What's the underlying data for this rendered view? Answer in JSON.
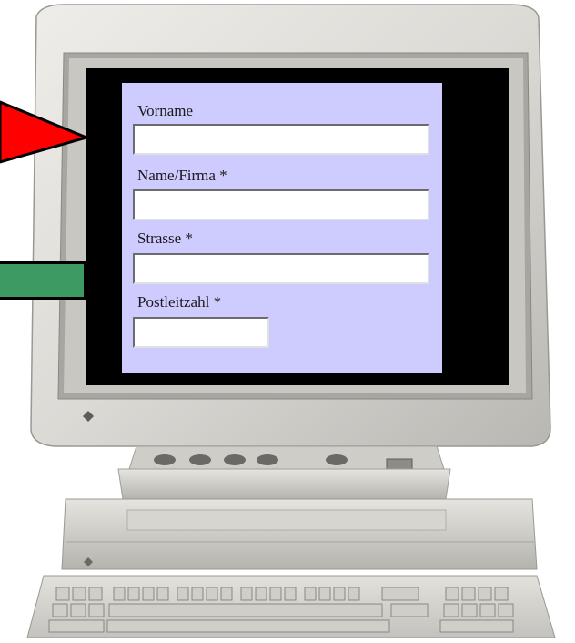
{
  "form": {
    "fields": [
      {
        "label": "Vorname",
        "value": ""
      },
      {
        "label": "Name/Firma *",
        "value": ""
      },
      {
        "label": "Strasse *",
        "value": ""
      },
      {
        "label": "Postleitzahl *",
        "value": ""
      }
    ]
  },
  "colors": {
    "form_background": "#cecbff",
    "arrow": "#ff0000",
    "bar": "#3d9a63",
    "monitor_case": "#dcdad5"
  },
  "icons": {
    "monitor": "computer-monitor-icon",
    "arrow": "red-arrow-icon"
  }
}
